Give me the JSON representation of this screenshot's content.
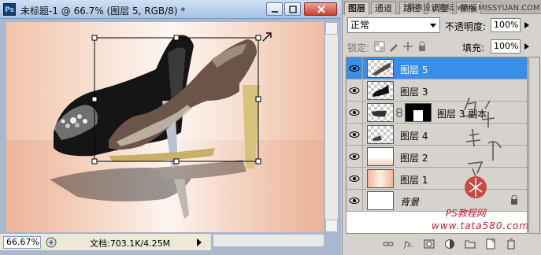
{
  "document": {
    "title": "未标题-1 @ 66.7% (图层 5, RGB/8) *",
    "zoom": "66.67%",
    "doc_info": "文档:703.1K/4.25M"
  },
  "panel": {
    "tabs": [
      "图层",
      "通道",
      "路径",
      "调整",
      "蒙版"
    ],
    "tab_watermark": "思缘设计论坛 www.MISSYUAN.COM",
    "blend_mode": "正常",
    "opacity_label": "不透明度:",
    "opacity_value": "100%",
    "lock_label": "锁定:",
    "fill_label": "填充:",
    "fill_value": "100%",
    "layers": [
      {
        "name": "图层 5",
        "selected": true
      },
      {
        "name": "图层 3",
        "selected": false
      },
      {
        "name": "图层 3 副本",
        "selected": false
      },
      {
        "name": "图层 4",
        "selected": false
      },
      {
        "name": "图层 2",
        "selected": false
      },
      {
        "name": "图层 1",
        "selected": false
      },
      {
        "name": "背景",
        "selected": false
      }
    ]
  },
  "watermarks": {
    "ps_site": "PS教程网",
    "url": "www.tata580.com",
    "signature": "他山我帮你"
  },
  "colors": {
    "selection_blue": "#3a8ee6",
    "watermark_red": "#bb2233"
  },
  "icons": {
    "bottom_bar": [
      "link-icon",
      "fx-icon",
      "mask-icon",
      "adjustment-icon",
      "group-icon",
      "new-layer-icon",
      "trash-icon"
    ]
  }
}
